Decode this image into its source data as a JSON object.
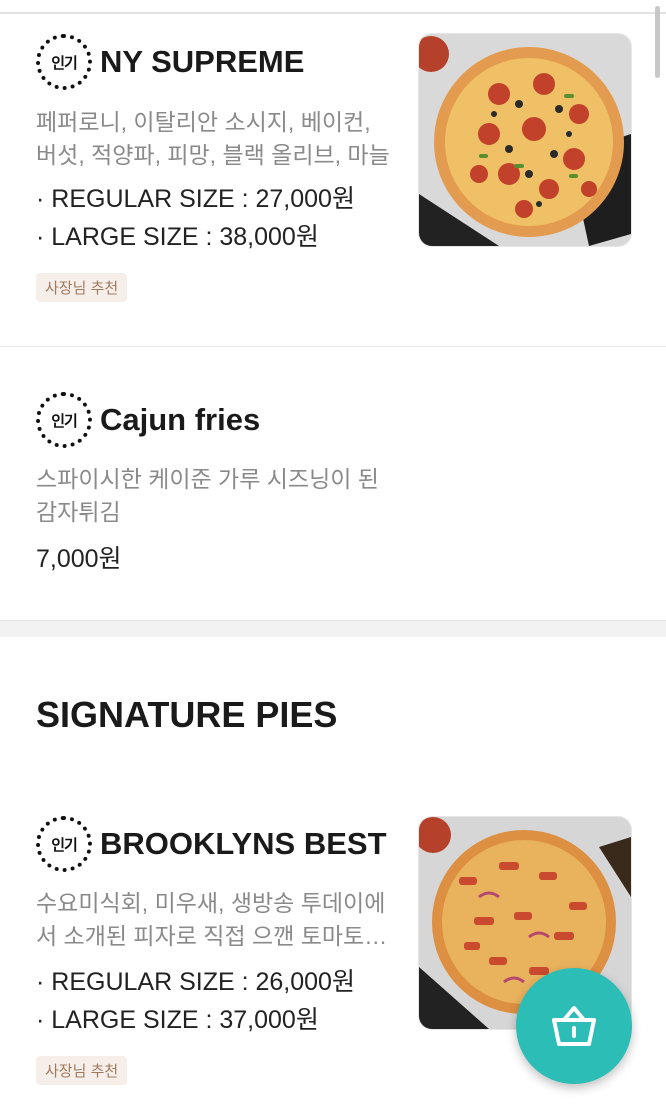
{
  "colors": {
    "accent": "#2bbdb6",
    "tag_bg": "#f6efe9",
    "tag_text": "#a07a5f"
  },
  "badge_text": "인기",
  "items": [
    {
      "name": "NY SUPREME",
      "description": "페퍼로니, 이탈리안 소시지, 베이컨, 버섯, 적양파, 피망, 블랙 올리브, 마늘",
      "prices": [
        "· REGULAR SIZE : 27,000원",
        "· LARGE SIZE : 38,000원"
      ],
      "tag": "사장님 추천",
      "image_icon": "pizza-photo"
    },
    {
      "name": "Cajun fries",
      "description": "스파이시한 케이준 가루 시즈닝이 된 감자튀김",
      "price": "7,000원"
    }
  ],
  "section": {
    "title": "SIGNATURE PIES"
  },
  "signature_items": [
    {
      "name": "BROOKLYNS BEST",
      "description": "수요미식회, 미우새, 생방송 투데이에서 소개된 피자로 직접 으깬 토마토…",
      "prices": [
        "· REGULAR SIZE : 26,000원",
        "· LARGE SIZE : 37,000원"
      ],
      "tag": "사장님 추천",
      "image_icon": "pizza-photo"
    }
  ],
  "cart": {
    "icon": "basket-icon"
  }
}
